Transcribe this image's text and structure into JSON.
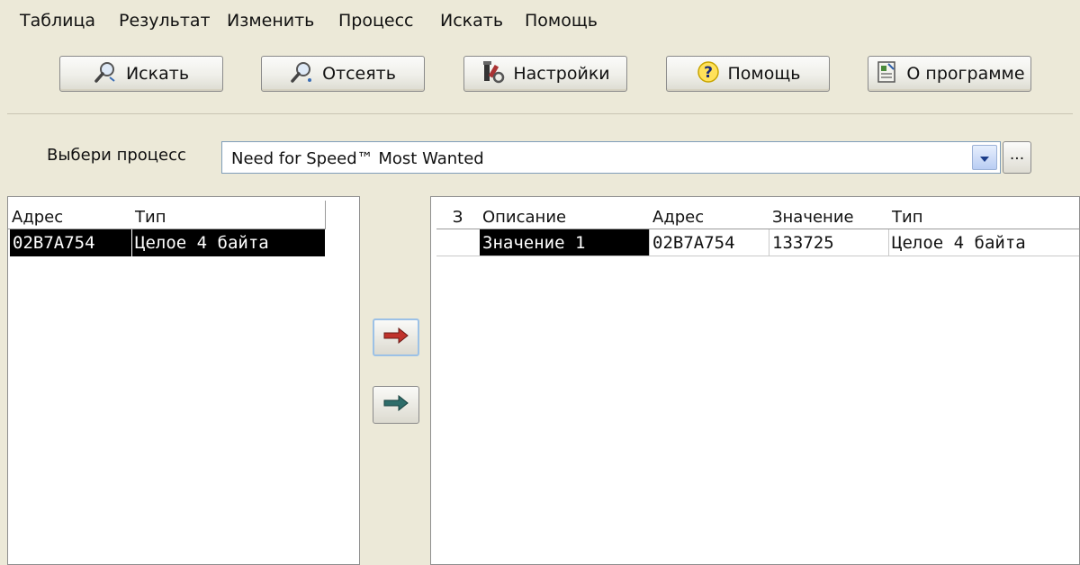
{
  "menu": [
    "Таблица",
    "Результат",
    "Изменить",
    "Процесс",
    "Искать",
    "Помощь"
  ],
  "toolbar": {
    "search_label": "Искать",
    "filter_label": "Отсеять",
    "settings_label": "Настройки",
    "help_label": "Помощь",
    "about_label": "О программе",
    "search_icon": "magnifier-icon",
    "filter_icon": "magnifier-filter-icon",
    "settings_icon": "tools-icon",
    "help_icon": "question-icon",
    "about_icon": "info-document-icon"
  },
  "process": {
    "label": "Выбери процесс",
    "selected": "Need for Speed™ Most Wanted",
    "browse_label": "..."
  },
  "left_table": {
    "columns": [
      "Адрес",
      "Тип"
    ],
    "rows": [
      {
        "address": "02B7A754",
        "type": "Целое 4 байта",
        "selected": true
      }
    ]
  },
  "transfer": {
    "add_icon": "arrow-right-red-icon",
    "add_all_icon": "arrow-right-teal-icon",
    "add_color": "#c0322b",
    "add_all_color": "#2e6d6a"
  },
  "right_table": {
    "columns": [
      "З",
      "Описание",
      "Адрес",
      "Значение",
      "Тип"
    ],
    "rows": [
      {
        "frozen": "",
        "description": "Значение 1",
        "address": "02B7A754",
        "value": "133725",
        "type": "Целое 4 байта"
      }
    ]
  }
}
